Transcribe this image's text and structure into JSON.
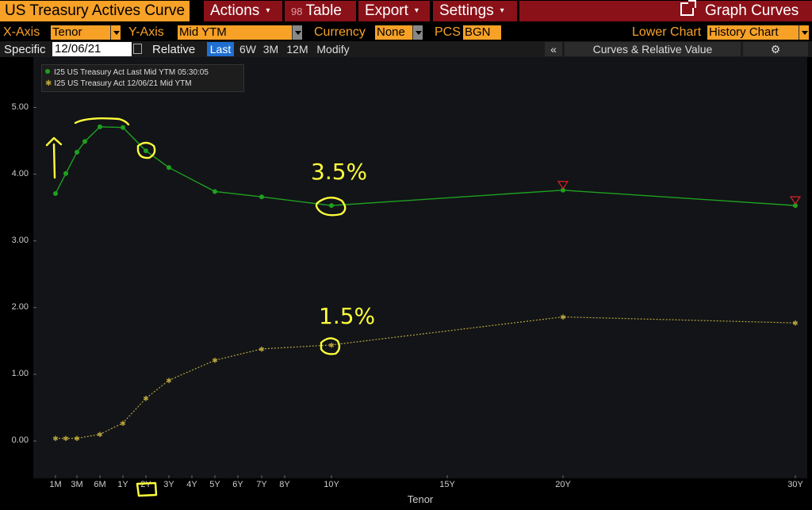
{
  "window": {
    "title": "US Treasury Actives Curve",
    "menus": [
      {
        "label": "Actions",
        "caret": "▾"
      },
      {
        "label": "Table",
        "icon": "table-icon"
      },
      {
        "label": "Export",
        "caret": "▾"
      },
      {
        "label": "Settings",
        "caret": "▾"
      }
    ],
    "graph_curves": "Graph Curves"
  },
  "controls": {
    "xaxis_label": "X-Axis",
    "xaxis_value": "Tenor",
    "yaxis_label": "Y-Axis",
    "yaxis_value": "Mid YTM",
    "currency_label": "Currency",
    "currency_value": "None",
    "pcs_label": "PCS",
    "pcs_value": "BGN",
    "lower_chart_label": "Lower Chart",
    "lower_chart_value": "History Chart"
  },
  "toolbar": {
    "specific_label": "Specific",
    "date": "12/06/21",
    "relative_label": "Relative",
    "periods": [
      "Last",
      "6W",
      "3M",
      "12M"
    ],
    "active_period": "Last",
    "modify_label": "Modify",
    "collapse_glyph": "«",
    "panel_title": "Curves & Relative Value"
  },
  "annotations": {
    "label_10y_top": "3.5%",
    "label_10y_bottom": "1.5%"
  },
  "colors": {
    "accent_orange": "#f7a127",
    "menu_red": "#8b1119",
    "series_current": "#1fa01f",
    "series_prior": "#b8a43a",
    "annotation": "#ffff3a"
  },
  "chart_data": {
    "type": "line",
    "xlabel": "Tenor",
    "ylabel": "",
    "ylim": [
      -0.5,
      5.75
    ],
    "yticks": [
      "0.00",
      "1.00",
      "2.00",
      "3.00",
      "4.00",
      "5.00"
    ],
    "xticks": [
      "1M",
      "3M",
      "6M",
      "1Y",
      "2Y",
      "3Y",
      "4Y",
      "5Y",
      "6Y",
      "7Y",
      "8Y",
      "10Y",
      "15Y",
      "20Y",
      "30Y"
    ],
    "legend_position": "top-left",
    "series": [
      {
        "name": "I25 US Treasury Act Last Mid YTM 05:30:05",
        "points": [
          [
            "1M",
            3.71
          ],
          [
            "2M",
            4.01
          ],
          [
            "3M",
            4.33
          ],
          [
            "4M",
            4.49
          ],
          [
            "6M",
            4.71
          ],
          [
            "1Y",
            4.7
          ],
          [
            "2Y",
            4.35
          ],
          [
            "3Y",
            4.1
          ],
          [
            "5Y",
            3.74
          ],
          [
            "7Y",
            3.66
          ],
          [
            "10Y",
            3.53
          ],
          [
            "20Y",
            3.76
          ],
          [
            "30Y",
            3.53
          ]
        ]
      },
      {
        "name": "I25 US Treasury Act 12/06/21 Mid YTM",
        "points": [
          [
            "1M",
            0.04
          ],
          [
            "2M",
            0.04
          ],
          [
            "3M",
            0.04
          ],
          [
            "6M",
            0.1
          ],
          [
            "1Y",
            0.27
          ],
          [
            "2Y",
            0.64
          ],
          [
            "3Y",
            0.91
          ],
          [
            "5Y",
            1.21
          ],
          [
            "7Y",
            1.38
          ],
          [
            "10Y",
            1.44
          ],
          [
            "20Y",
            1.86
          ],
          [
            "30Y",
            1.77
          ]
        ]
      }
    ]
  }
}
